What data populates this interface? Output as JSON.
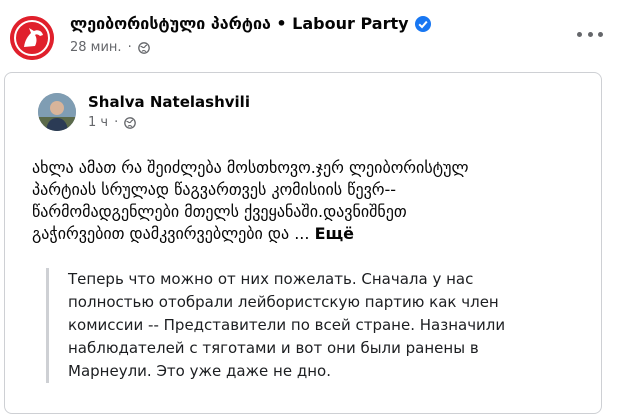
{
  "header": {
    "page_name": "ლეიბორისტული პარტია • Labour Party",
    "time": "28 мин.",
    "verified_color": "#1877f2",
    "brand_color": "#e0202c"
  },
  "shared_post": {
    "author": "Shalva Natelashvili",
    "time": "1 ч",
    "text_lines": [
      "ახლა ამათ რა შეიძლება მოსთხოვო.ჯერ ლეიბორისტულ",
      "პარტიას სრულად  წაგვართვეს კომისიის წევრ--",
      "წარმომადგენლები მთელს ქვეყანაში.დავნიშნეთ",
      "გაჭირვებით დამკვირვებლები და ..."
    ],
    "see_more": "Ещё",
    "quote_lines": [
      "Теперь что можно от них пожелать. Сначала у нас",
      "полностью отобрали лейбористскую партию как член",
      "комиссии -- Представители по всей стране. Назначили",
      "наблюдателей с тяготами и вот они были ранены в",
      "Марнеули. Это уже даже не дно."
    ]
  },
  "icons": {
    "page_avatar": "horse-logo-icon",
    "verified": "verified-badge-icon",
    "privacy": "globe-icon",
    "more": "more-options-icon"
  }
}
